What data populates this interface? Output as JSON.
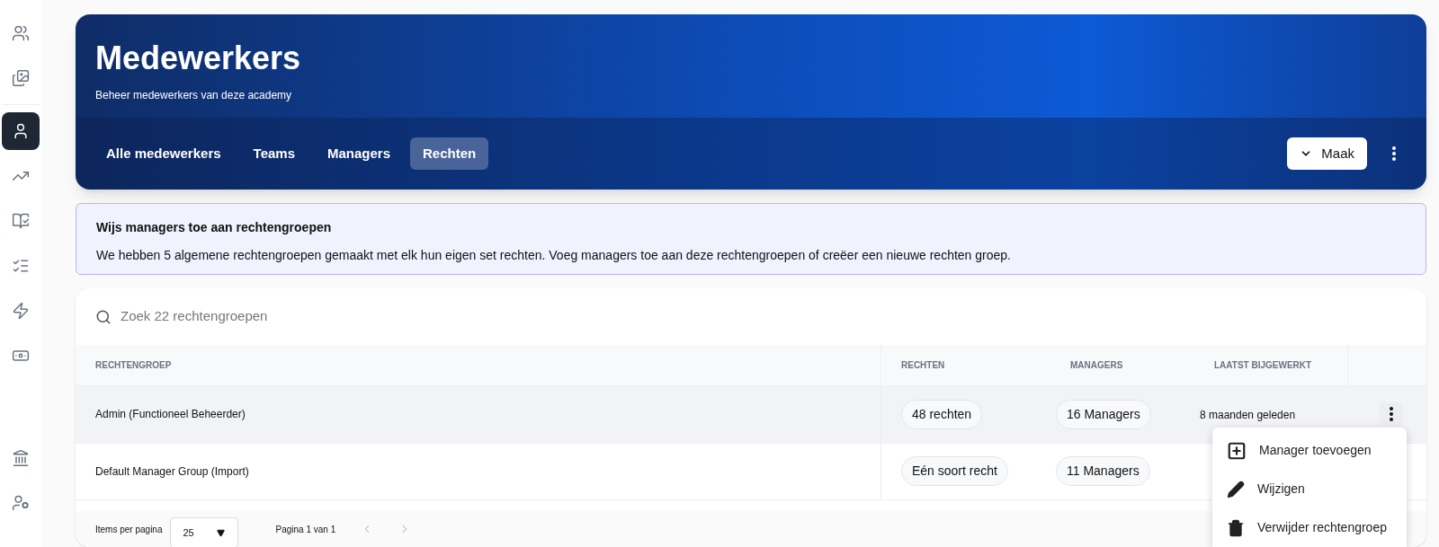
{
  "sidebar": {
    "items": [
      {
        "kind": "users",
        "selected": false
      },
      {
        "kind": "images",
        "selected": false
      },
      {
        "kind": "user",
        "selected": true
      },
      {
        "kind": "trend",
        "selected": false
      },
      {
        "kind": "book",
        "selected": false
      },
      {
        "kind": "checklist",
        "selected": false
      },
      {
        "kind": "bolt",
        "selected": false
      },
      {
        "kind": "money",
        "selected": false
      }
    ],
    "bottom_items": [
      {
        "kind": "bank",
        "selected": false
      },
      {
        "kind": "usergear",
        "selected": false
      }
    ]
  },
  "header": {
    "title": "Medewerkers",
    "subtitle": "Beheer medewerkers van deze academy",
    "tabs": [
      {
        "label": "Alle medewerkers",
        "selected": false
      },
      {
        "label": "Teams",
        "selected": false
      },
      {
        "label": "Managers",
        "selected": false
      },
      {
        "label": "Rechten",
        "selected": true
      }
    ],
    "create_button": "Maak"
  },
  "info": {
    "title": "Wijs managers toe aan rechtengroepen",
    "text": "We hebben 5 algemene rechtengroepen gemaakt met elk hun eigen set rechten. Voeg managers toe aan deze rechtengroepen of creëer een nieuwe rechten groep."
  },
  "table": {
    "search": {
      "placeholder": "Zoek 22 rechtengroepen"
    },
    "columns": [
      "RECHTENGROEP",
      "RECHTEN",
      "MANAGERS",
      "LAATST BIJGEWERKT"
    ],
    "rows": [
      {
        "name": "Admin (Functioneel Beheerder)",
        "rights": "48 rechten",
        "managers": "16 Managers",
        "updated": "8 maanden geleden",
        "highlighted": true
      },
      {
        "name": "Default Manager Group (Import)",
        "rights": "Eén soort recht",
        "managers": "11 Managers",
        "updated": "",
        "highlighted": false
      }
    ],
    "footer": {
      "items_label": "Items per pagina",
      "page_size": "25",
      "page_label": "Pagina 1 van 1"
    }
  },
  "menu": {
    "items": [
      {
        "kind": "add",
        "label": "Manager toevoegen"
      },
      {
        "kind": "edit",
        "label": "Wijzigen"
      },
      {
        "kind": "delete",
        "label": "Verwijder rechtengroep"
      }
    ]
  }
}
